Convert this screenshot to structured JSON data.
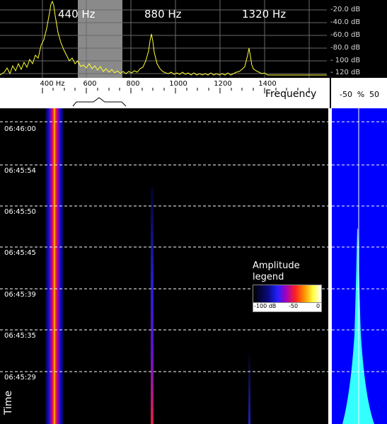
{
  "spectrum": {
    "peak_labels": [
      "440 Hz",
      "880 Hz",
      "1320 Hz"
    ],
    "db_labels": [
      "-20.0 dB",
      "-40.0 dB",
      "-60.0 dB",
      "-80.0 dB",
      "- 100 dB",
      "- 120 dB"
    ],
    "trace_color": "#ffff33",
    "band_color": "#8a8a8a"
  },
  "frequency_axis": {
    "tick_labels": [
      "400 Hz",
      "600",
      "800",
      "1000",
      "1200",
      "1400"
    ],
    "title": "Frequency"
  },
  "percent_axis": {
    "tick_labels": [
      "-50",
      "%",
      "50"
    ]
  },
  "waterfall": {
    "time_labels": [
      "06:46:00",
      "06:45:54",
      "06:45:50",
      "06:45:45",
      "06:45:39",
      "06:45:35",
      "06:45:29"
    ],
    "time_title": "Time"
  },
  "legend": {
    "title": "Amplitude legend",
    "scale_labels": [
      "-100 dB",
      "-50",
      "0"
    ]
  },
  "colors": {
    "histogram_background": "#0000ff",
    "histogram_fill": "#33ffff"
  }
}
